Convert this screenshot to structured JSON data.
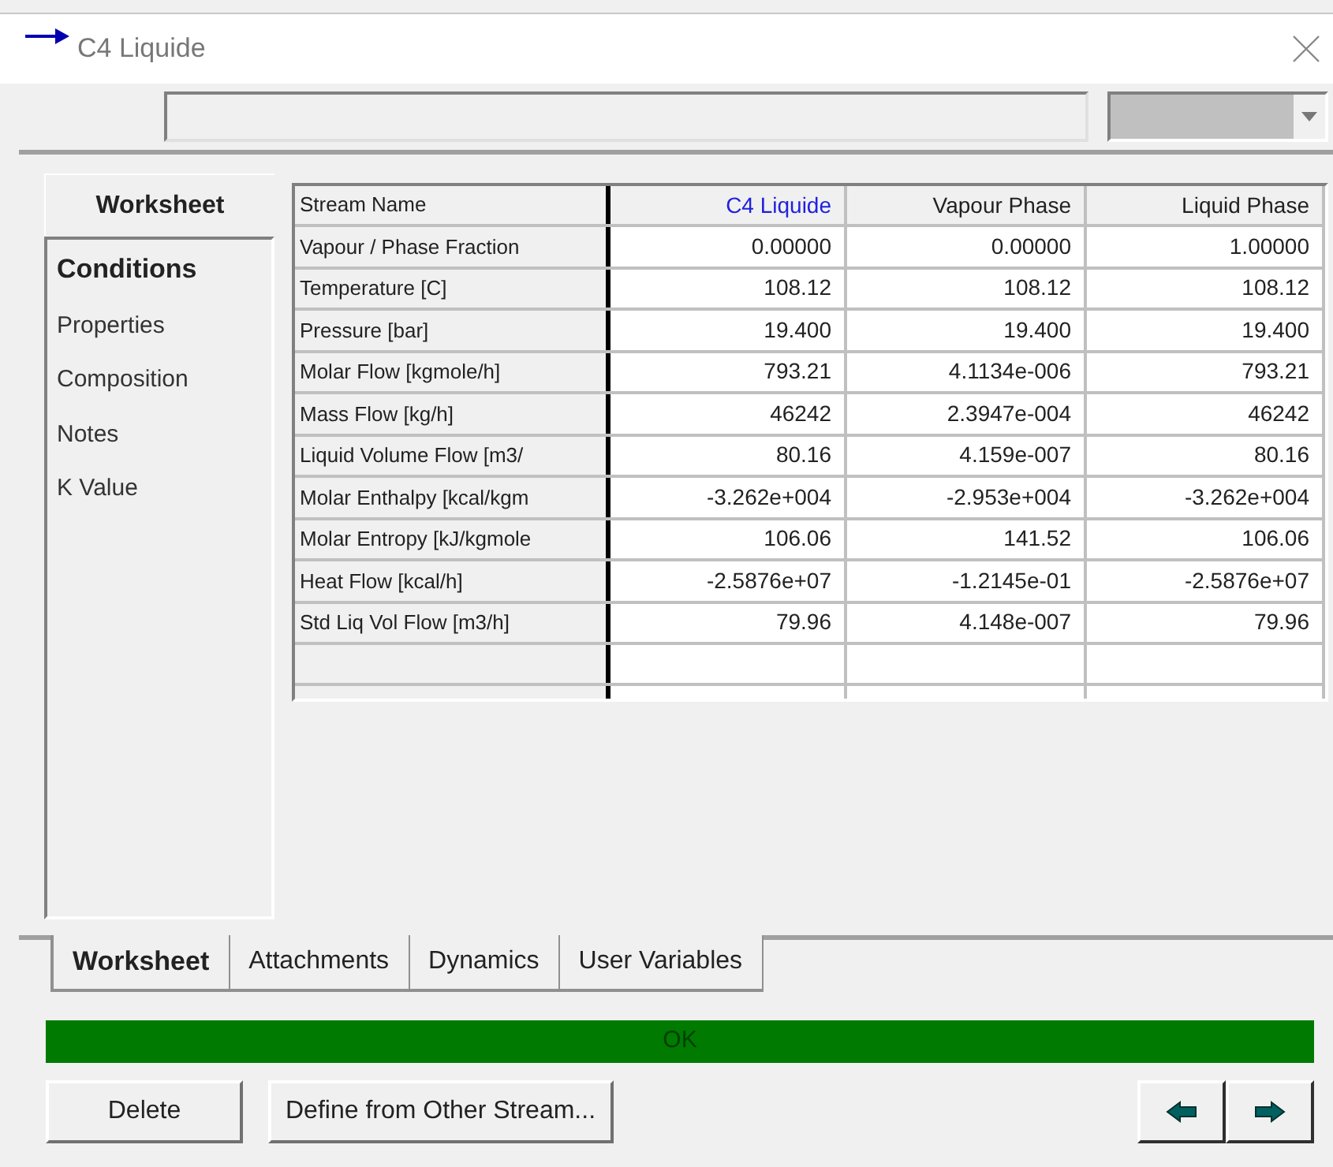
{
  "window": {
    "title": "C4 Liquide"
  },
  "sidebar": {
    "heading": "Worksheet",
    "items": [
      {
        "label": "Conditions",
        "selected": true
      },
      {
        "label": "Properties",
        "selected": false
      },
      {
        "label": "Composition",
        "selected": false
      },
      {
        "label": "Notes",
        "selected": false
      },
      {
        "label": "K Value",
        "selected": false
      }
    ]
  },
  "table": {
    "columns": [
      {
        "label": "Stream Name",
        "highlighted": false
      },
      {
        "label": "C4 Liquide",
        "highlighted": true
      },
      {
        "label": "Vapour Phase",
        "highlighted": false
      },
      {
        "label": "Liquid Phase",
        "highlighted": false
      }
    ],
    "rows": [
      [
        "Vapour / Phase Fraction",
        "0.00000",
        "0.00000",
        "1.00000"
      ],
      [
        "Temperature [C]",
        "108.12",
        "108.12",
        "108.12"
      ],
      [
        "Pressure [bar]",
        "19.400",
        "19.400",
        "19.400"
      ],
      [
        "Molar Flow [kgmole/h]",
        "793.21",
        "4.1134e-006",
        "793.21"
      ],
      [
        "Mass Flow [kg/h]",
        "46242",
        "2.3947e-004",
        "46242"
      ],
      [
        "Liquid Volume Flow [m3/",
        "80.16",
        "4.159e-007",
        "80.16"
      ],
      [
        "Molar Enthalpy [kcal/kgm",
        "-3.262e+004",
        "-2.953e+004",
        "-3.262e+004"
      ],
      [
        "Molar Entropy [kJ/kgmole",
        "106.06",
        "141.52",
        "106.06"
      ],
      [
        "Heat Flow [kcal/h]",
        "-2.5876e+07",
        "-1.2145e-01",
        "-2.5876e+07"
      ],
      [
        "Std Liq Vol Flow [m3/h]",
        "79.96",
        "4.148e-007",
        "79.96"
      ]
    ]
  },
  "tabs": [
    {
      "label": "Worksheet",
      "selected": true
    },
    {
      "label": "Attachments",
      "selected": false
    },
    {
      "label": "Dynamics",
      "selected": false
    },
    {
      "label": "User Variables",
      "selected": false
    }
  ],
  "status_bar": {
    "text": "OK"
  },
  "buttons": [
    "Delete",
    "Define from Other Stream..."
  ]
}
